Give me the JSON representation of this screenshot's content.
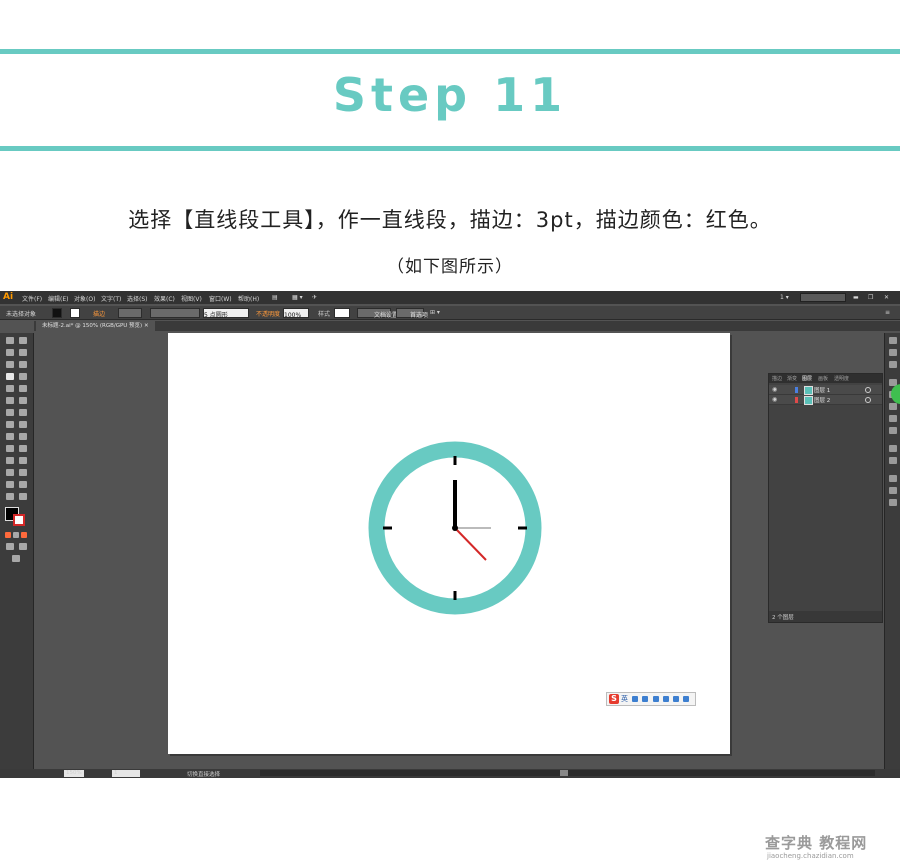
{
  "header": {
    "title": "Step 11",
    "instruction": "选择【直线段工具】，作一直线段，描边：3pt，描边颜色：红色。",
    "subnote": "（如下图所示）"
  },
  "colors": {
    "accent": "#68cac2",
    "clock_ring": "#68cac2",
    "second_hand": "#d42828"
  },
  "app": {
    "logo": "Ai",
    "menus": [
      "文件(F)",
      "编辑(E)",
      "对象(O)",
      "文字(T)",
      "选择(S)",
      "效果(C)",
      "视图(V)",
      "窗口(W)",
      "帮助(H)"
    ],
    "workspace_value": "1",
    "control": {
      "selection": "未选择对象",
      "stroke_label": "描边",
      "brush_value": "5 点圆形",
      "opacity_label": "不透明度",
      "opacity_value": "100%",
      "style_label": "样式",
      "doc_setup": "文档设置",
      "prefs": "首选项"
    },
    "doc_tab": "未标题-2.ai* @ 150% (RGB/GPU 预览)",
    "status": {
      "zoom": "150%",
      "page": "1",
      "tool": "切换直接选择"
    }
  },
  "layers_panel": {
    "tabs": [
      "描边",
      "渐变",
      "图层",
      "画板",
      "透明度"
    ],
    "layers": [
      {
        "name": "图层 1",
        "color": "#4a7fe0"
      },
      {
        "name": "图层 2",
        "color": "#e04a4a"
      }
    ],
    "footer": "2 个图层"
  },
  "ime": {
    "lang": "英"
  },
  "watermark": {
    "main": "查字典 教程网",
    "url": "jiaocheng.chazidian.com"
  }
}
